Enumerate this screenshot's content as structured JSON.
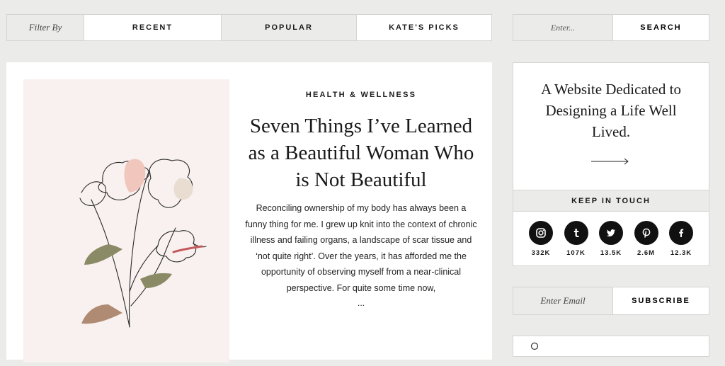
{
  "filter": {
    "label": "Filter By",
    "tabs": [
      {
        "label": "RECENT"
      },
      {
        "label": "POPULAR"
      },
      {
        "label": "KATE'S PICKS"
      }
    ]
  },
  "search": {
    "placeholder": "Enter...",
    "button_label": "SEARCH"
  },
  "article": {
    "category": "HEALTH & WELLNESS",
    "title": "Seven Things I’ve Learned as a Beautiful Woman Who is Not Beautiful",
    "excerpt": "Reconciling ownership of my body has always been a funny thing for me. I grew up knit into the context of chronic illness and failing organs, a landscape of scar tissue and ‘not quite right’. Over the years, it has afforded me the opportunity of observing myself from a near-clinical perspective. For quite some time now,",
    "ellipsis": "..."
  },
  "sidebar": {
    "tagline": "A Website Dedicated to Designing a Life Well Lived.",
    "keep_in_touch": "KEEP IN TOUCH",
    "social": [
      {
        "icon": "instagram-icon",
        "count": "332K"
      },
      {
        "icon": "tumblr-icon",
        "count": "107K"
      },
      {
        "icon": "twitter-icon",
        "count": "13.5K"
      },
      {
        "icon": "pinterest-icon",
        "count": "2.6M"
      },
      {
        "icon": "facebook-icon",
        "count": "12.3K"
      }
    ]
  },
  "subscribe": {
    "placeholder": "Enter Email",
    "button_label": "SUBSCRIBE"
  },
  "colors": {
    "page_bg": "#ebebe9",
    "card_bg": "#ffffff",
    "art_bg": "#f8f1ef",
    "social_bg": "#111111"
  }
}
